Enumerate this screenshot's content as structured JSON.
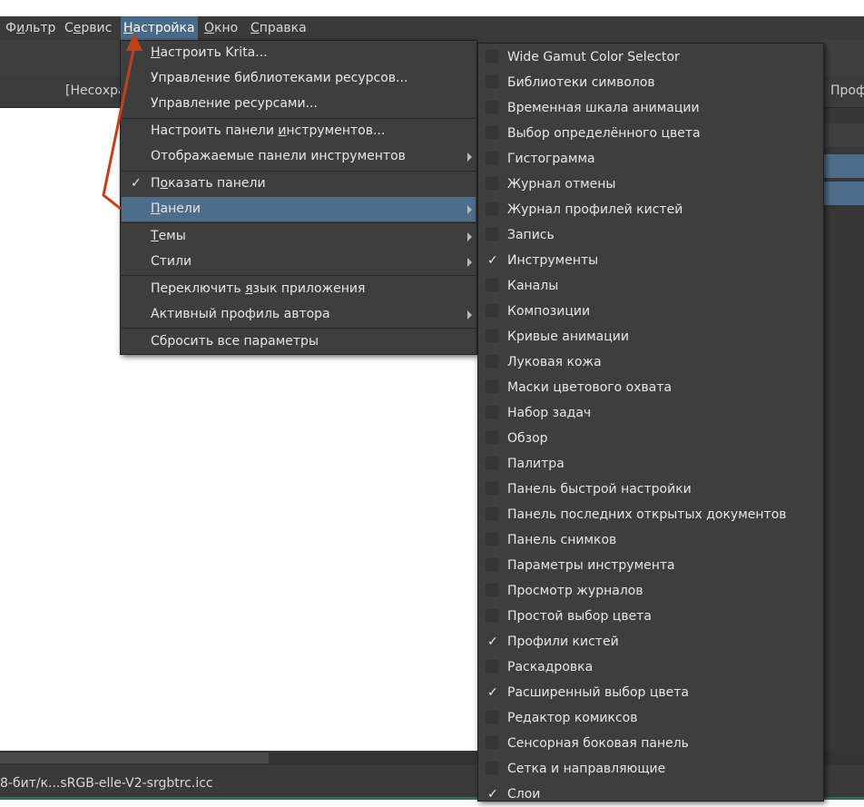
{
  "menubar": {
    "items": [
      {
        "label": "Фильтр",
        "u": 1
      },
      {
        "label": "Сервис",
        "u": 1
      },
      {
        "label": "Настройка",
        "u": 0
      },
      {
        "label": "Окно",
        "u": 0
      },
      {
        "label": "Справка",
        "u": 0
      }
    ]
  },
  "toolbar": {
    "tab_label": "[Несохра",
    "right_label": "Проф"
  },
  "status": {
    "profile": "8-бит/к...sRGB-elle-V2-srgbtrc.icc"
  },
  "settings_menu": {
    "items": [
      "Настроить Krita...",
      "Управление библиотеками ресурсов...",
      "Управление ресурсами...",
      "Настроить панели инструментов...",
      "Отображаемые панели инструментов",
      "Показать панели",
      "Панели",
      "Темы",
      "Стили",
      "Переключить язык приложения",
      "Активный профиль автора",
      "Сбросить все параметры"
    ]
  },
  "dockers_menu": {
    "items": [
      {
        "label": "Wide Gamut Color Selector",
        "checked": false
      },
      {
        "label": "Библиотеки символов",
        "checked": false
      },
      {
        "label": "Временная шкала анимации",
        "checked": false
      },
      {
        "label": "Выбор определённого цвета",
        "checked": false
      },
      {
        "label": "Гистограмма",
        "checked": false
      },
      {
        "label": "Журнал отмены",
        "checked": false
      },
      {
        "label": "Журнал профилей кистей",
        "checked": false
      },
      {
        "label": "Запись",
        "checked": false
      },
      {
        "label": "Инструменты",
        "checked": true
      },
      {
        "label": "Каналы",
        "checked": false
      },
      {
        "label": "Композиции",
        "checked": false
      },
      {
        "label": "Кривые анимации",
        "checked": false
      },
      {
        "label": "Луковая кожа",
        "checked": false
      },
      {
        "label": "Маски цветового охвата",
        "checked": false
      },
      {
        "label": "Набор задач",
        "checked": false
      },
      {
        "label": "Обзор",
        "checked": false
      },
      {
        "label": "Палитра",
        "checked": false
      },
      {
        "label": "Панель быстрой настройки",
        "checked": false
      },
      {
        "label": "Панель последних открытых документов",
        "checked": false
      },
      {
        "label": "Панель снимков",
        "checked": false
      },
      {
        "label": "Параметры инструмента",
        "checked": false
      },
      {
        "label": "Просмотр журналов",
        "checked": false
      },
      {
        "label": "Простой выбор цвета",
        "checked": false
      },
      {
        "label": "Профили кистей",
        "checked": true
      },
      {
        "label": "Раскадровка",
        "checked": false
      },
      {
        "label": "Расширенный выбор цвета",
        "checked": true
      },
      {
        "label": "Редактор комиксов",
        "checked": false
      },
      {
        "label": "Сенсорная боковая панель",
        "checked": false
      },
      {
        "label": "Сетка и направляющие",
        "checked": false
      },
      {
        "label": "Слои",
        "checked": true
      }
    ]
  },
  "check_mark": "✓",
  "colors": {
    "menu_bg": "#3e3e3e",
    "highlight": "#4e6c8c",
    "annotation_arrow": "#c0401a"
  }
}
